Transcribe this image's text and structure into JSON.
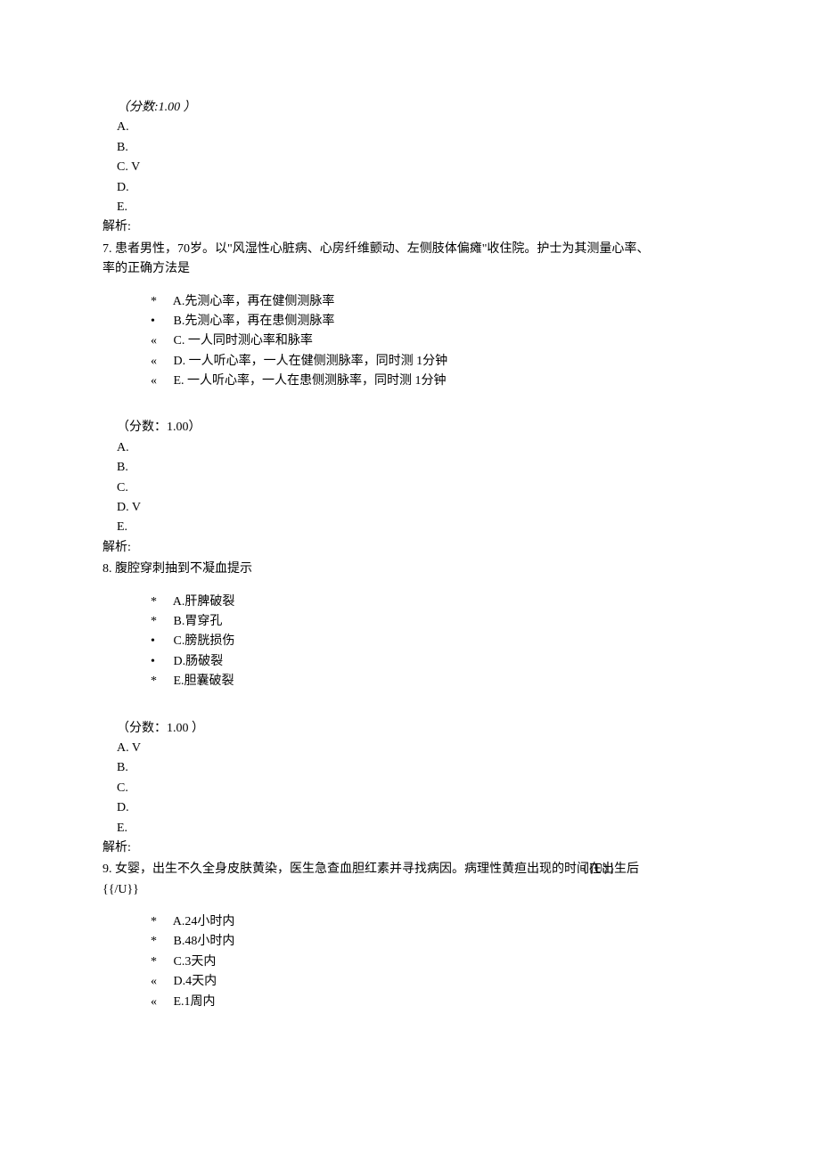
{
  "q6": {
    "score": "（分数:1.00 ）",
    "answers": [
      "A.",
      "B.",
      "C.    V",
      "D.",
      "E."
    ],
    "jiexi": "解析:"
  },
  "q7": {
    "num": "7.",
    "stem1": "  患者男性，70岁。以\"风湿性心脏病、心房纤维颤动、左侧肢体偏瘫\"收住院。护士为其测量心率、",
    "stem2": "率的正确方法是",
    "options": [
      {
        "bullet": "*",
        "text": "     A.先测心率，再在健侧测脉率"
      },
      {
        "bullet": "•",
        "text": " B.先测心率，再在患侧测脉率"
      },
      {
        "bullet": "«",
        "text": " C. 一人同时测心率和脉率"
      },
      {
        "bullet": "«",
        "text": " D. 一人听心率，一人在健侧测脉率，同时测           1分钟"
      },
      {
        "bullet": "«",
        "text": " E. 一人听心率，一人在患侧测脉率，同时测           1分钟"
      }
    ],
    "score": "（分数：1.00）",
    "answers": [
      "A.",
      "B.",
      "C.",
      "D.    V",
      "E."
    ],
    "jiexi": "解析:"
  },
  "q8": {
    "num": "8.",
    "stem": "  腹腔穿刺抽到不凝血提示",
    "options": [
      {
        "bullet": "*",
        "text": "     A.肝脾破裂"
      },
      {
        "bullet": "*",
        "text": "     B.胃穿孔"
      },
      {
        "bullet": "•",
        "text": " C.膀胱损伤"
      },
      {
        "bullet": "•",
        "text": " D.肠破裂"
      },
      {
        "bullet": "*",
        "text": "     E.胆囊破裂"
      }
    ],
    "score": "（分数：1.00 ）",
    "answers": [
      "A.    V",
      "B.",
      "C.",
      "D.",
      "E."
    ],
    "jiexi": "解析:"
  },
  "q9": {
    "num": "9.",
    "stem": "  女婴，出生不久全身皮肤黄染，医生急查血胆红素并寻找病因。病理性黄疸出现的时间在出生后",
    "u1": "{{U}}",
    "u2": "{{/U}}",
    "options": [
      {
        "bullet": "*",
        "text": "     A.24小时内"
      },
      {
        "bullet": "*",
        "text": "     B.48小时内"
      },
      {
        "bullet": "*",
        "text": "     C.3天内"
      },
      {
        "bullet": "«",
        "text": "    D.4天内"
      },
      {
        "bullet": "«",
        "text": "    E.1周内"
      }
    ]
  }
}
